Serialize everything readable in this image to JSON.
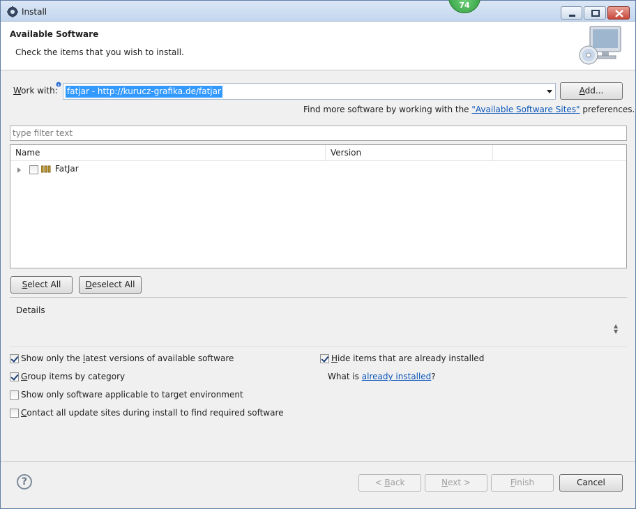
{
  "window": {
    "title": "Install",
    "badge_count": "74"
  },
  "header": {
    "title": "Available Software",
    "subtitle": "Check the items that you wish to install."
  },
  "work_with": {
    "label_prefix": "W",
    "label_rest": "ork with:",
    "value": "fatjar - http://kurucz-grafika.de/fatjar",
    "add_label_prefix": "A",
    "add_label_rest": "dd..."
  },
  "more_software": {
    "text_before": "Find more software by working with the ",
    "link": "\"Available Software Sites\"",
    "text_after": " preferences."
  },
  "filter": {
    "placeholder": "type filter text"
  },
  "table": {
    "columns": [
      "Name",
      "Version"
    ],
    "rows": [
      {
        "name": "FatJar",
        "version": "",
        "checked": false
      }
    ]
  },
  "selection_buttons": {
    "select_all_prefix": "S",
    "select_all_rest": "elect All",
    "deselect_all_prefix": "D",
    "deselect_all_rest": "eselect All"
  },
  "details": {
    "label": "Details"
  },
  "options": {
    "latest_versions": {
      "before": "Show only the ",
      "mn": "l",
      "after": "atest versions of available software",
      "checked": true
    },
    "group_by_category": {
      "mn": "G",
      "after": "roup items by category",
      "checked": true
    },
    "target_env": {
      "label": "Show only software applicable to target environment",
      "checked": false
    },
    "contact_sites": {
      "mn": "C",
      "after": "ontact all update sites during install to find required software",
      "checked": false
    },
    "hide_installed": {
      "mn": "H",
      "after": "ide items that are already installed",
      "checked": true
    },
    "what_is_before": "What is ",
    "what_is_link": "already installed",
    "what_is_after": "?"
  },
  "footer": {
    "help": "?",
    "back_pre": "< ",
    "back_mn": "B",
    "back_rest": "ack",
    "next_mn": "N",
    "next_rest": "ext >",
    "finish_mn": "F",
    "finish_rest": "inish",
    "cancel": "Cancel"
  }
}
